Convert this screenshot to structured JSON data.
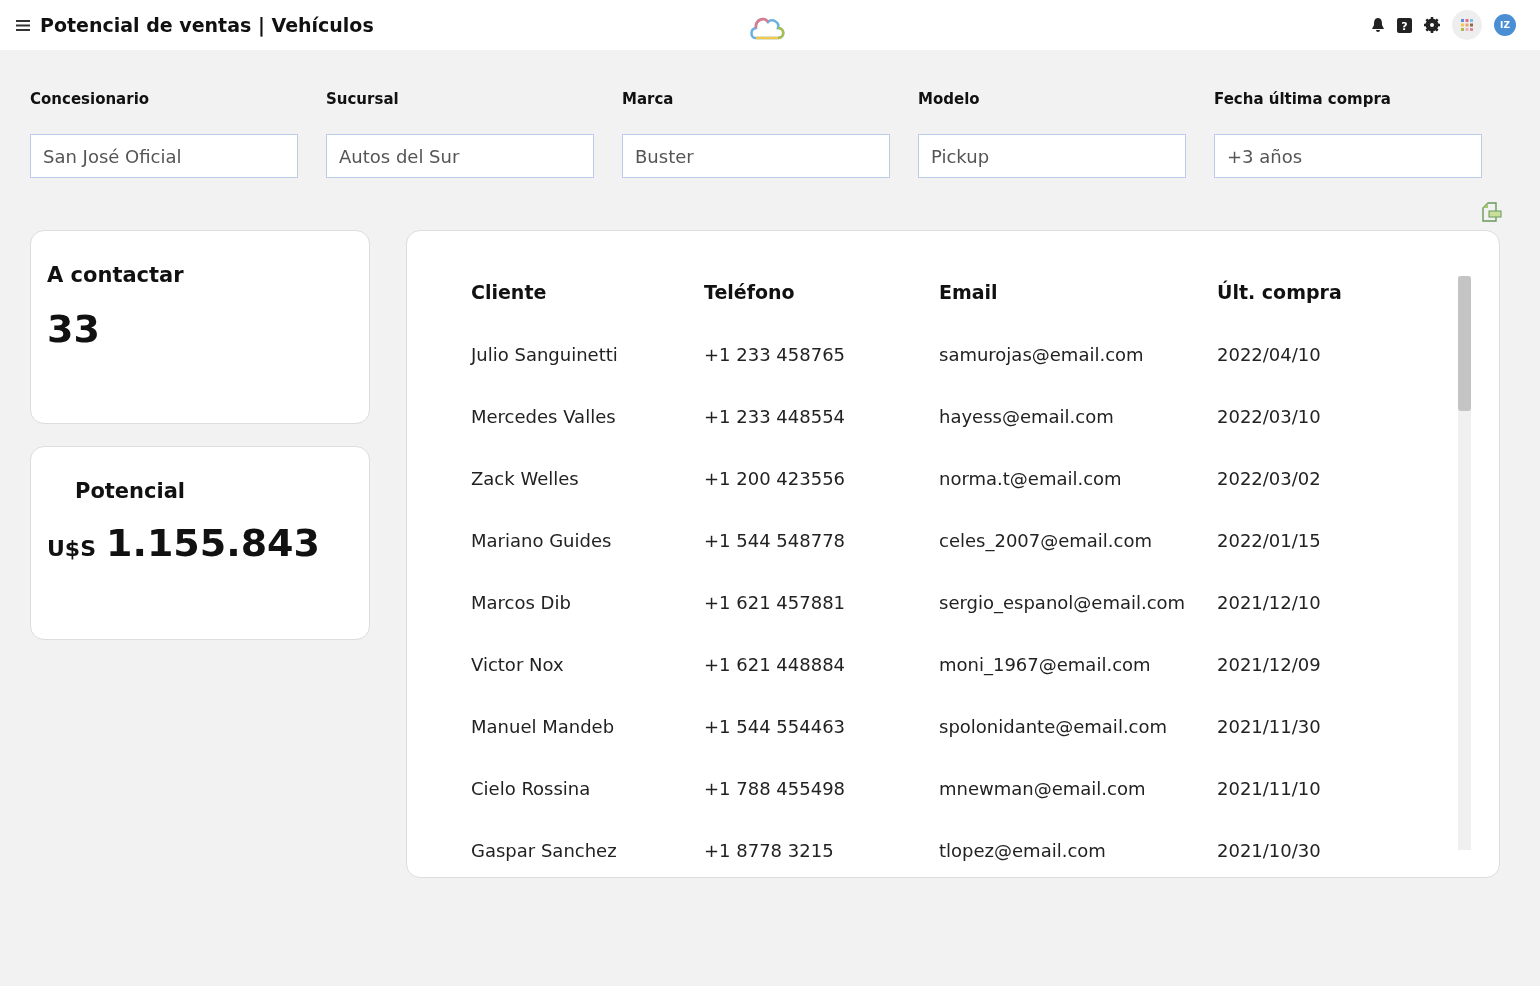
{
  "header": {
    "title": "Potencial de ventas | Vehículos",
    "avatar": "IZ",
    "help_glyph": "?"
  },
  "filters": [
    {
      "label": "Concesionario",
      "value": "San José Oficial"
    },
    {
      "label": "Sucursal",
      "value": "Autos del Sur"
    },
    {
      "label": "Marca",
      "value": "Buster"
    },
    {
      "label": "Modelo",
      "value": "Pickup"
    },
    {
      "label": "Fecha última compra",
      "value": "+3 años"
    }
  ],
  "cards": [
    {
      "title": "A contactar",
      "value": "33"
    },
    {
      "title": "Potencial",
      "currency": "U$S",
      "value": "1.155.843"
    }
  ],
  "table": {
    "columns": [
      "Cliente",
      "Teléfono",
      "Email",
      "Últ. compra"
    ],
    "rows": [
      [
        "Julio Sanguinetti",
        "+1 233 458765",
        "samurojas@email.com",
        "2022/04/10"
      ],
      [
        "Mercedes Valles",
        "+1 233 448554",
        "hayess@email.com",
        "2022/03/10"
      ],
      [
        "Zack Welles",
        "+1 200 423556",
        "norma.t@email.com",
        "2022/03/02"
      ],
      [
        "Mariano Guides",
        "+1 544 548778",
        "celes_2007@email.com",
        "2022/01/15"
      ],
      [
        "Marcos Dib",
        "+1 621 457881",
        "sergio_espanol@email.com",
        "2021/12/10"
      ],
      [
        "Victor Nox",
        "+1 621 448884",
        "moni_1967@email.com",
        "2021/12/09"
      ],
      [
        "Manuel Mandeb",
        "+1 544 554463",
        "spolonidante@email.com",
        "2021/11/30"
      ],
      [
        "Cielo Rossina",
        "+1 788 455498",
        "mnewman@email.com",
        "2021/11/10"
      ],
      [
        "Gaspar Sanchez",
        "+1 8778 3215",
        "tlopez@email.com",
        "2021/10/30"
      ]
    ]
  }
}
